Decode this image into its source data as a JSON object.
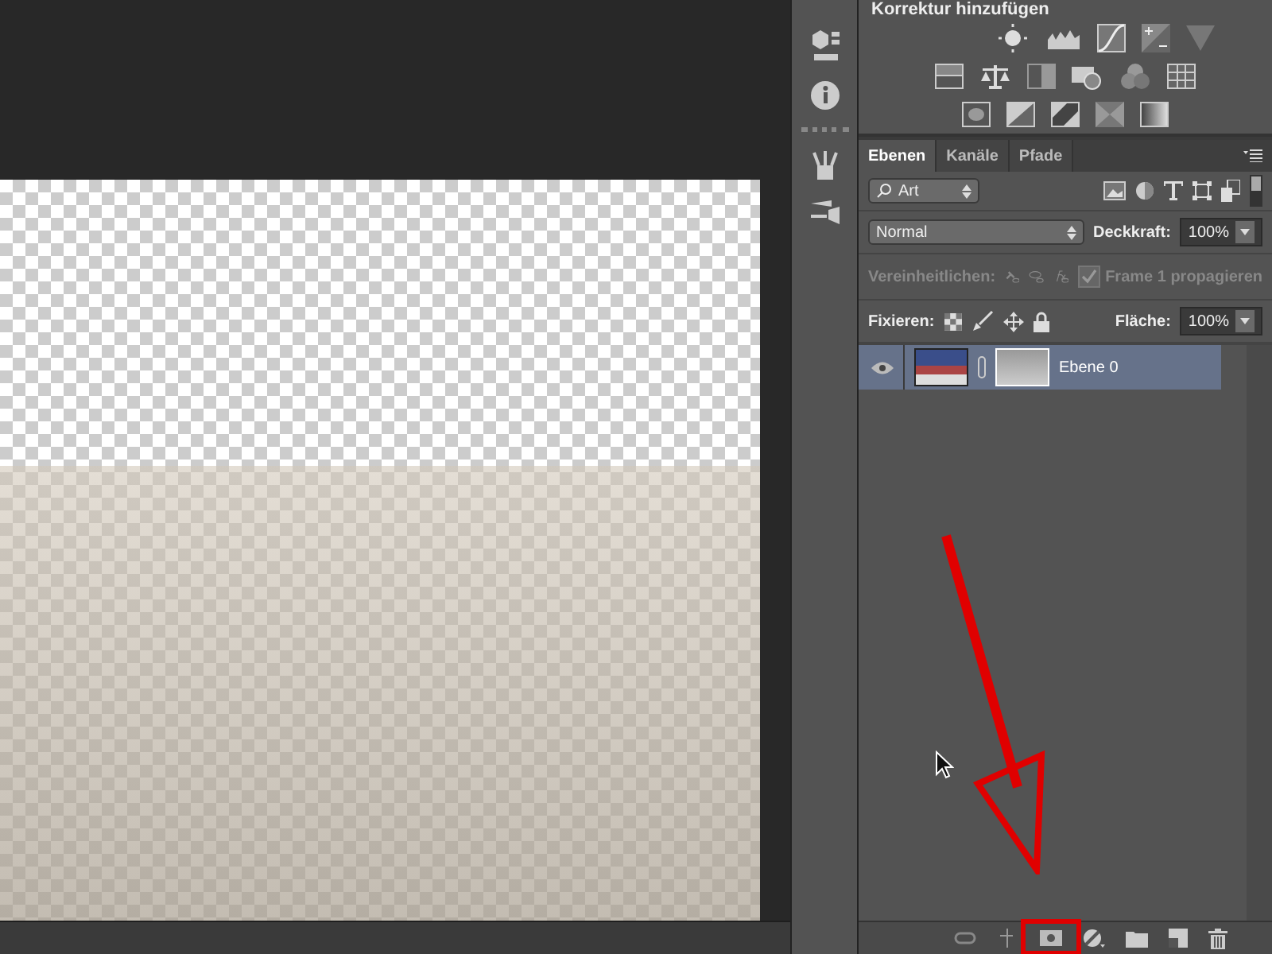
{
  "adjustments_panel": {
    "title": "Korrektur hinzufügen"
  },
  "layers_panel": {
    "tabs": [
      {
        "label": "Ebenen",
        "selected": true
      },
      {
        "label": "Kanäle",
        "selected": false
      },
      {
        "label": "Pfade",
        "selected": false
      }
    ],
    "filter": {
      "value": "Art"
    },
    "blend_mode": "Normal",
    "opacity": {
      "label": "Deckkraft:",
      "value": "100%"
    },
    "unify": {
      "label": "Vereinheitlichen:"
    },
    "propagate": {
      "label": "Frame 1 propagieren",
      "checked": true,
      "disabled": true
    },
    "lock": {
      "label": "Fixieren:"
    },
    "fill": {
      "label": "Fläche:",
      "value": "100%"
    },
    "layers": [
      {
        "name": "Ebene 0",
        "visible": true,
        "selected": true
      }
    ]
  }
}
